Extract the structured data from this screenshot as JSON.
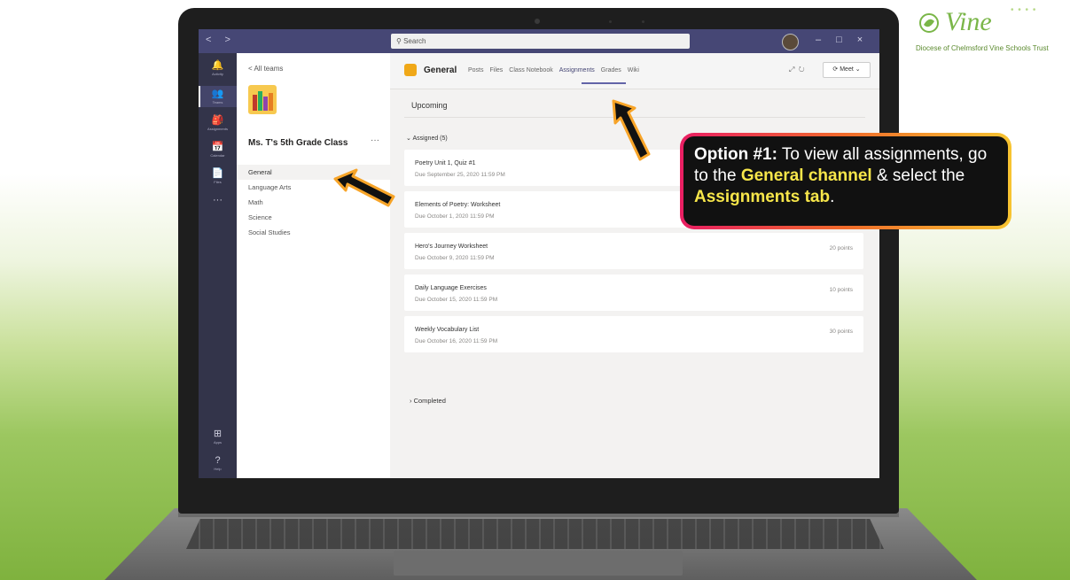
{
  "logo": {
    "word": "Vine",
    "subtitle": "Diocese of Chelmsford Vine Schools Trust"
  },
  "titlebar": {
    "nav": "< >",
    "search_placeholder": "Search",
    "controls": [
      "–",
      "□",
      "×"
    ]
  },
  "rail": [
    {
      "label": "Activity",
      "icon": "bell-icon",
      "glyph": "🔔"
    },
    {
      "label": "Teams",
      "icon": "teams-icon",
      "glyph": "👥"
    },
    {
      "label": "Assignments",
      "icon": "assignments-icon",
      "glyph": "🎒"
    },
    {
      "label": "Calendar",
      "icon": "calendar-icon",
      "glyph": "📅"
    },
    {
      "label": "Files",
      "icon": "files-icon",
      "glyph": "📄"
    },
    {
      "label": "",
      "icon": "more-icon",
      "glyph": "···"
    },
    {
      "label": "Apps",
      "icon": "apps-icon",
      "glyph": "⊞"
    },
    {
      "label": "Help",
      "icon": "help-icon",
      "glyph": "?"
    }
  ],
  "chanlist": {
    "back": "< All teams",
    "team_name": "Ms. T's 5th Grade Class",
    "more": "···",
    "channels": [
      "General",
      "Language Arts",
      "Math",
      "Science",
      "Social Studies"
    ]
  },
  "header": {
    "channel": "General",
    "tabs": [
      "Posts",
      "Files",
      "Class Notebook",
      "Assignments",
      "Grades",
      "Wiki"
    ],
    "active_tab": "Assignments",
    "meet": "⟳ Meet ⌄"
  },
  "main": {
    "upcoming": "Upcoming",
    "assigned": "Assigned (5)",
    "completed": "Completed",
    "assignments": [
      {
        "title": "Poetry Unit 1, Quiz #1",
        "due": "Due September 25, 2020 11:59 PM",
        "points": ""
      },
      {
        "title": "Elements of Poetry: Worksheet",
        "due": "Due October 1, 2020 11:59 PM",
        "points": ""
      },
      {
        "title": "Hero's Journey Worksheet",
        "due": "Due October 9, 2020 11:59 PM",
        "points": "20 points"
      },
      {
        "title": "Daily Language Exercises",
        "due": "Due October 15, 2020 11:59 PM",
        "points": "10 points"
      },
      {
        "title": "Weekly Vocabulary List",
        "due": "Due October 16, 2020 11:59 PM",
        "points": "30 points"
      }
    ]
  },
  "callout": {
    "lead": "Option #1:",
    "t1": " To view all assignments, go to the ",
    "h1": "General channel",
    "t2": " & select the ",
    "h2": "Assignments tab",
    "t3": "."
  },
  "colors": {
    "teams_purple": "#464775",
    "rail": "#33344a",
    "highlight": "#f7e64a"
  }
}
